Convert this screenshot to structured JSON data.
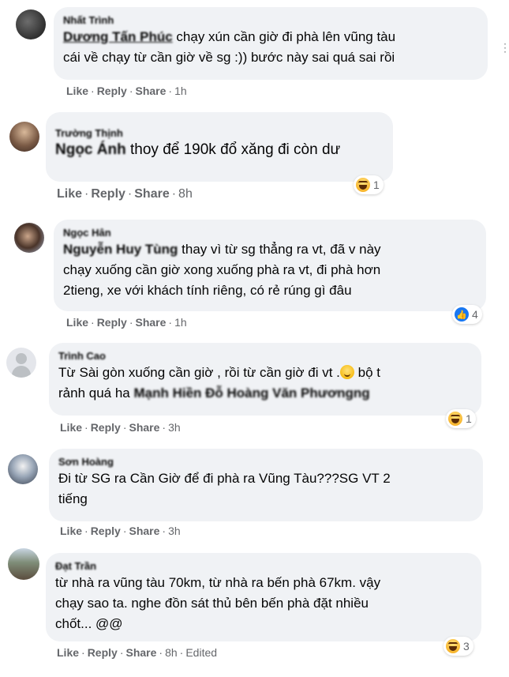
{
  "actions": {
    "like": "Like",
    "reply": "Reply",
    "share": "Share",
    "dot": "·"
  },
  "comments": [
    {
      "author": "Nhất Trình",
      "mention": "Dương Tấn Phúc",
      "lines": [
        " chạy xún cần giờ đi phà lên vũng tàu",
        "cái về chạy từ cần giờ về sg :)) bước này sai quá sai rồi"
      ],
      "time": "1h"
    },
    {
      "author": "Trường Thịnh",
      "mention": "Ngọc Ánh",
      "lines": [
        " thoy để 190k đổ xăng đi còn dư"
      ],
      "time": "8h",
      "reaction": {
        "type": "haha",
        "count": "1"
      }
    },
    {
      "author": "Ngọc Hân",
      "mention": "Nguyễn Huy Tùng",
      "lines": [
        " thay vì từ sg thẳng ra vt, đã v này",
        "chạy xuống cần giờ xong xuống phà ra vt, đi phà hơn",
        "2tieng, xe với khách tính riêng, có rẻ rúng gì đâu"
      ],
      "time": "1h",
      "reaction": {
        "type": "like",
        "count": "4"
      }
    },
    {
      "author": "Trình Cao",
      "line1": "Từ Sài gòn xuống cần giờ , rồi từ cần giờ đi vt .",
      "line1_end": " bộ t",
      "line2_prefix": "rảnh quá ha ",
      "mentions2": "Mạnh Hiền Đỗ  Hoàng Văn Phươngng",
      "time": "3h",
      "reaction": {
        "type": "haha",
        "count": "1"
      }
    },
    {
      "author": "Sơn Hoàng",
      "lines": [
        "Đi từ SG ra Cần Giờ để đi phà ra Vũng Tàu???SG VT 2",
        "tiếng"
      ],
      "time": "3h"
    },
    {
      "author": "Đạt Trần",
      "lines": [
        "từ nhà ra vũng tàu 70km, từ nhà ra bến phà 67km. vậy",
        "chạy sao ta. nghe đồn sát thủ bên bến phà đặt nhiều",
        "chốt... @@"
      ],
      "time": "8h",
      "edited": "Edited",
      "reaction": {
        "type": "haha",
        "count": "3"
      }
    }
  ]
}
